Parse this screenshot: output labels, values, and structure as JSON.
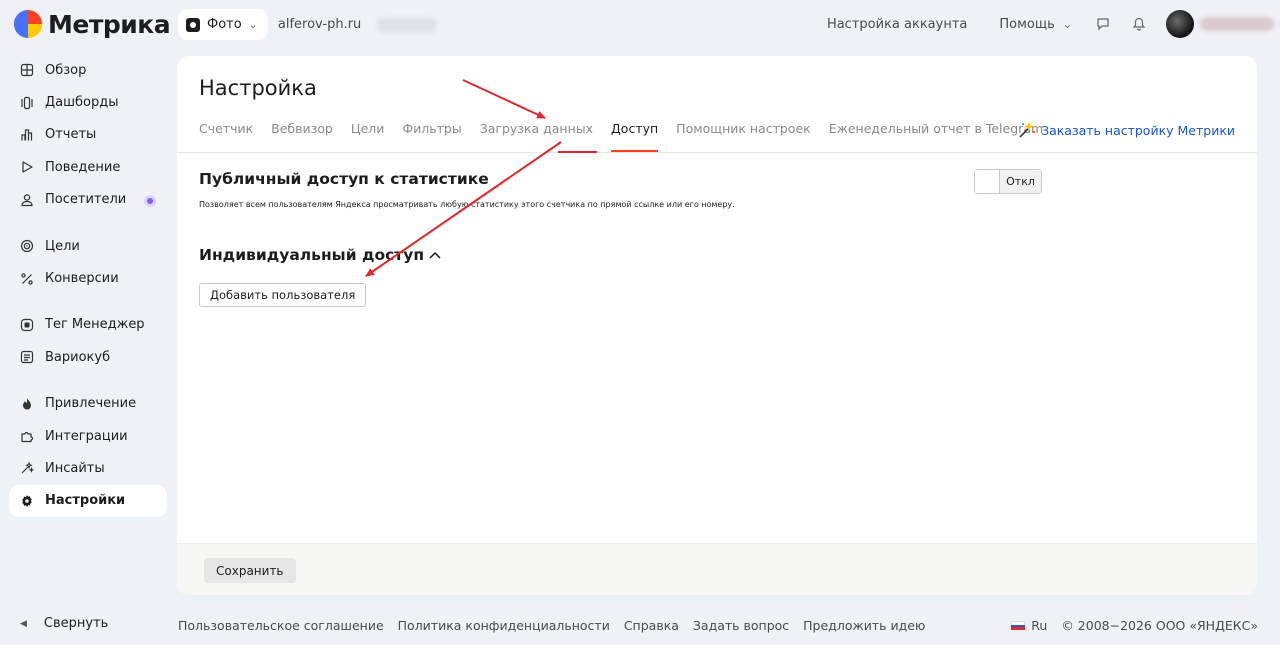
{
  "header": {
    "logo_text": "Метрика",
    "counter_name": "Фото",
    "site": "alferov-ph.ru",
    "account_settings": "Настройка аккаунта",
    "help": "Помощь"
  },
  "sidebar": {
    "items": [
      {
        "label": "Обзор",
        "icon": "grid-icon"
      },
      {
        "label": "Дашборды",
        "icon": "dashboard-icon"
      },
      {
        "label": "Отчеты",
        "icon": "bar-chart-icon"
      },
      {
        "label": "Поведение",
        "icon": "play-icon"
      },
      {
        "label": "Посетители",
        "icon": "person-icon"
      },
      {
        "label": "Цели",
        "icon": "target-icon"
      },
      {
        "label": "Конверсии",
        "icon": "percent-icon"
      },
      {
        "label": "Тег Менеджер",
        "icon": "tag-manager-icon"
      },
      {
        "label": "Вариокуб",
        "icon": "variocube-icon"
      },
      {
        "label": "Привлечение",
        "icon": "flame-icon"
      },
      {
        "label": "Интеграции",
        "icon": "puzzle-icon"
      },
      {
        "label": "Инсайты",
        "icon": "sparkle-icon"
      },
      {
        "label": "Настройки",
        "icon": "gear-icon"
      }
    ],
    "collapse_label": "Свернуть"
  },
  "main": {
    "title": "Настройка",
    "tabs": [
      "Счетчик",
      "Вебвизор",
      "Цели",
      "Фильтры",
      "Загрузка данных",
      "Доступ",
      "Помощник настроек",
      "Еженедельный отчет в Telegram"
    ],
    "active_tab": "Доступ",
    "order_link": "Заказать настройку Метрики",
    "public_access": {
      "title": "Публичный доступ к статистике",
      "description": "Позволяет всем пользователям Яндекса просматривать любую статистику этого счетчика по прямой ссылке или его номеру.",
      "toggle_label": "Откл"
    },
    "individual_access": {
      "title": "Индивидуальный доступ",
      "add_user_label": "Добавить пользователя"
    },
    "save_label": "Сохранить"
  },
  "footer": {
    "links": [
      "Пользовательское соглашение",
      "Политика конфиденциальности",
      "Справка",
      "Задать вопрос",
      "Предложить идею"
    ],
    "lang": "Ru",
    "copyright": "© 2008−2026 ООО «ЯНДЕКС»"
  },
  "colors": {
    "accent_red": "#fc3f1d",
    "link_blue": "#1a56c8",
    "annotation_arrow": "#e3262c"
  }
}
